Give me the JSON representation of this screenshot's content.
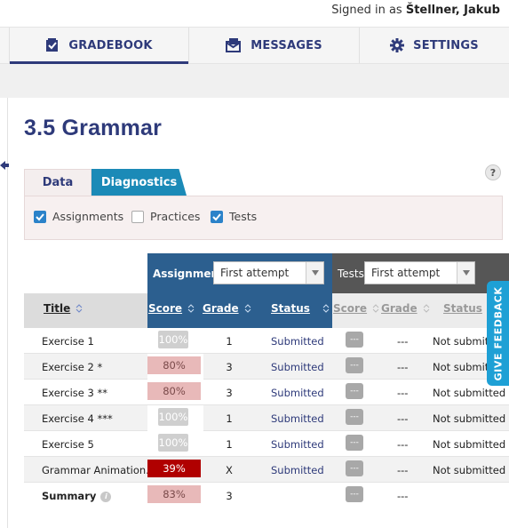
{
  "header": {
    "signed_in_label": "Signed in as",
    "user_name": "Štellner, Jakub"
  },
  "nav": [
    {
      "label": "GRADEBOOK",
      "icon": "gradebook-icon",
      "active": true
    },
    {
      "label": "MESSAGES",
      "icon": "messages-icon",
      "active": false
    },
    {
      "label": "SETTINGS",
      "icon": "gear-icon",
      "active": false
    }
  ],
  "page": {
    "title": "3.5 Grammar",
    "help": "?"
  },
  "tabs": [
    {
      "label": "Data",
      "active": true
    },
    {
      "label": "Diagnostics",
      "active": false
    }
  ],
  "filters": [
    {
      "label": "Assignments",
      "checked": true
    },
    {
      "label": "Practices",
      "checked": false
    },
    {
      "label": "Tests",
      "checked": true
    }
  ],
  "table": {
    "assignments_group": {
      "label": "Assignments",
      "attempt": "First attempt"
    },
    "tests_group": {
      "label": "Tests",
      "attempt": "First attempt"
    },
    "columns": {
      "title": "Title",
      "a_score": "Score",
      "a_grade": "Grade",
      "a_status": "Status",
      "t_score": "Score",
      "t_grade": "Grade",
      "t_status": "Status"
    },
    "rows": [
      {
        "title": "Exercise 1",
        "score": "100%",
        "grade": "1",
        "status": "Submitted",
        "t_score": "---",
        "t_grade": "---",
        "t_status": "Not submitted"
      },
      {
        "title": "Exercise 2 *",
        "score": "80%",
        "grade": "3",
        "status": "Submitted",
        "t_score": "---",
        "t_grade": "---",
        "t_status": "Not submitted"
      },
      {
        "title": "Exercise 3 **",
        "score": "80%",
        "grade": "3",
        "status": "Submitted",
        "t_score": "---",
        "t_grade": "---",
        "t_status": "Not submitted"
      },
      {
        "title": "Exercise 4 ***",
        "score": "100%",
        "grade": "1",
        "status": "Submitted",
        "t_score": "---",
        "t_grade": "---",
        "t_status": "Not submitted"
      },
      {
        "title": "Exercise 5",
        "score": "100%",
        "grade": "1",
        "status": "Submitted",
        "t_score": "---",
        "t_grade": "---",
        "t_status": "Not submitted"
      },
      {
        "title": "Grammar Animation...",
        "score": "39%",
        "grade": "X",
        "status": "Submitted",
        "t_score": "---",
        "t_grade": "---",
        "t_status": "Not submitted"
      }
    ],
    "summary": {
      "title": "Summary",
      "score": "83%",
      "grade": "3",
      "t_score": "---",
      "t_grade": "---"
    }
  },
  "feedback_tab": "GIVE FEEDBACK"
}
